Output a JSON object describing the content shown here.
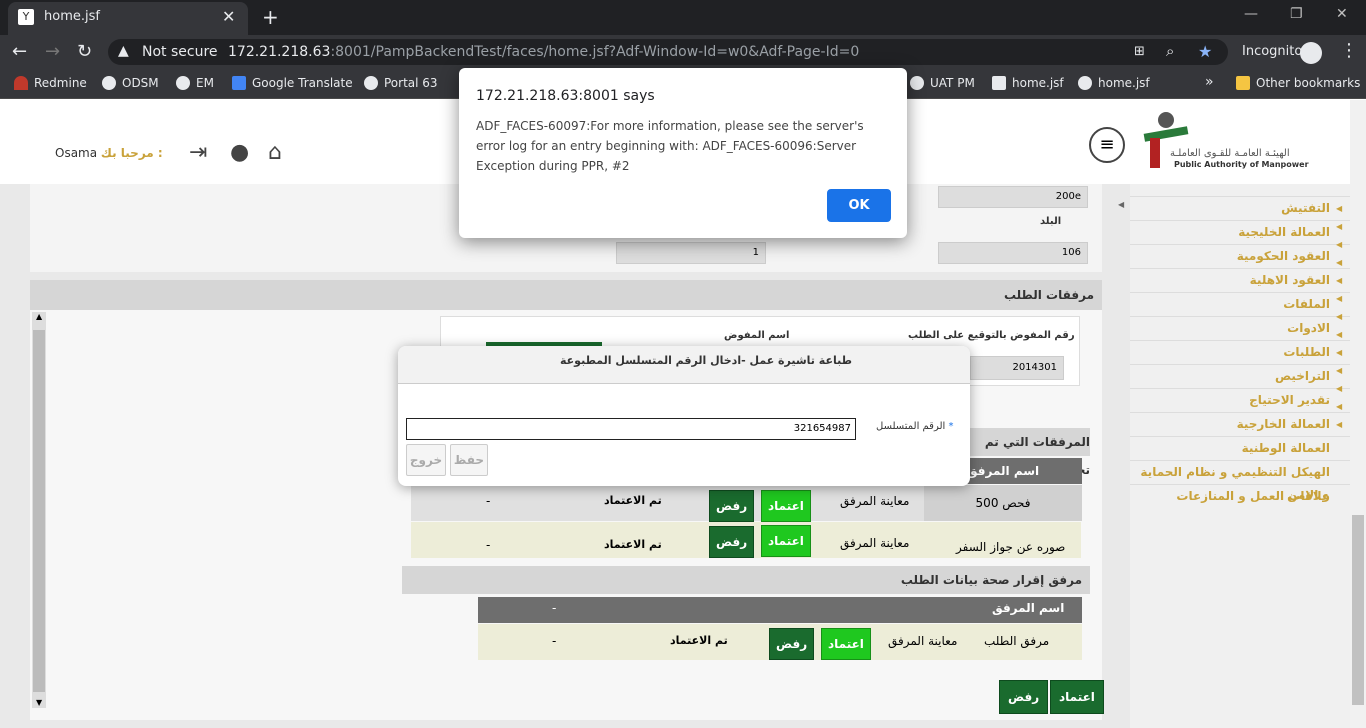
{
  "tab": {
    "title": "home.jsf"
  },
  "omnibox": {
    "security": "Not secure",
    "host": "172.21.218.63",
    "path": ":8001/PampBackendTest/faces/home.jsf?Adf-Window-Id=w0&Adf-Page-Id=0"
  },
  "profile": {
    "label": "Incognito"
  },
  "bookmarks": [
    "Redmine",
    "ODSM",
    "EM",
    "Google Translate",
    "Portal 63",
    "UAT PM",
    "home.jsf",
    "home.jsf",
    "Other bookmarks"
  ],
  "header": {
    "user": "Osama",
    "greeting": "مرحبا بك :",
    "org_ar": "الهيئـة العامـة للقـوى العاملـة",
    "org_en": "Public Authority of Manpower"
  },
  "sidebar": {
    "items": [
      "التفتيش",
      "العمالة الخليجية",
      "العقود الحكومية",
      "العقود الاهلية",
      "الملفات",
      "الادوات",
      "الطلبات",
      "التراخيص",
      "تقدير الاحتياج",
      "العمالة الخارجية",
      "العمالة الوطنية",
      "الهيكل التنظيمي و نظام الحماية و الامن",
      "علاقات العمل و المنازعات"
    ]
  },
  "top_form": {
    "val1": "200e",
    "country_label": "البلد",
    "val2": "106",
    "val3": "1"
  },
  "attach_section": {
    "title": "مرفقات الطلب",
    "sign_label": "رقم المفوض بالتوقيع على الطلب",
    "delegate_label": "اسم المفوض",
    "sign_value": "2014301"
  },
  "uploaded": {
    "title": "المرفقات التي تم تحميلها",
    "col_name": "اسم المرفق",
    "rows": [
      {
        "name": "فحص 500",
        "view": "معاينة المرفق",
        "approve": "اعتماد",
        "reject": "رفض",
        "status": "تم الاعتماد",
        "note": "-"
      },
      {
        "name": "صوره عن جواز السفر",
        "view": "معاينة المرفق",
        "approve": "اعتماد",
        "reject": "رفض",
        "status": "تم الاعتماد",
        "note": "-"
      }
    ]
  },
  "validity": {
    "title": "مرفق إقرار صحة بيانات الطلب",
    "col_name": "اسم المرفق",
    "col_last": "-",
    "row": {
      "name": "مرفق الطلب",
      "view": "معاينة المرفق",
      "approve": "اعتماد",
      "reject": "رفض",
      "status": "تم الاعتماد",
      "note": "-"
    }
  },
  "footer_actions": {
    "approve": "اعتماد",
    "reject": "رفض"
  },
  "dialog": {
    "title": "طباعة تاشيرة عمل -ادخال الرقم المتسلسل المطبوعة",
    "field_label": "الرقم المتسلسل",
    "required": "*",
    "value": "321654987",
    "save": "حفظ",
    "exit": "خروج"
  },
  "alert": {
    "title": "172.21.218.63:8001 says",
    "message": "ADF_FACES-60097:For more information, please see the server's error log for an entry beginning with: ADF_FACES-60096:Server Exception during PPR, #2",
    "ok": "OK"
  }
}
